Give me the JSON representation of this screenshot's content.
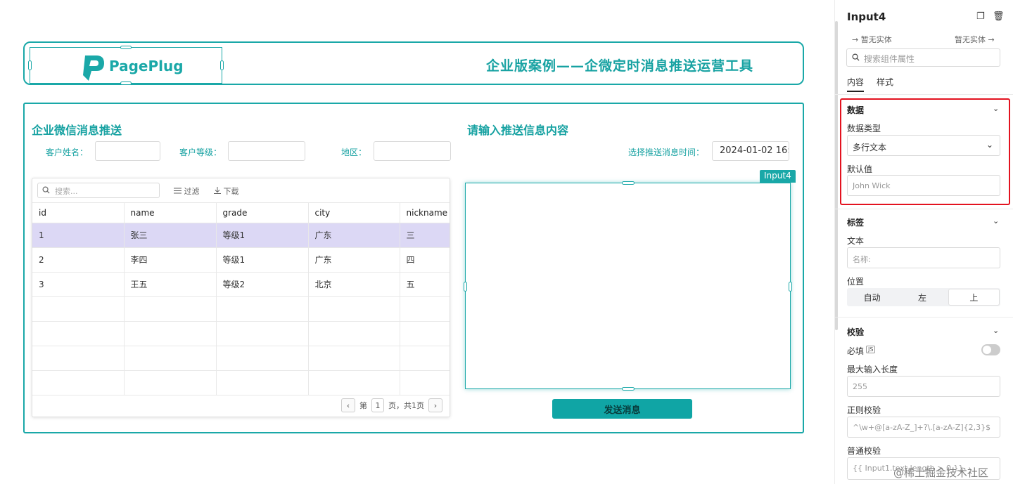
{
  "header": {
    "logo_text": "PagePlug",
    "title": "企业版案例——企微定时消息推送运营工具"
  },
  "main": {
    "left_title": "企业微信消息推送",
    "right_title": "请输入推送信息内容",
    "filters": [
      {
        "label": "客户姓名：",
        "value": ""
      },
      {
        "label": "客户等级：",
        "value": ""
      },
      {
        "label": "地区：",
        "value": ""
      }
    ],
    "schedule_label": "选择推送消息时间：",
    "schedule_value": "2024-01-02 16:",
    "table": {
      "search_placeholder": "搜索...",
      "filter_label": "过滤",
      "download_label": "下载",
      "columns": [
        "id",
        "name",
        "grade",
        "city",
        "nickname"
      ],
      "rows": [
        [
          "1",
          "张三",
          "等级1",
          "广东",
          "三"
        ],
        [
          "2",
          "李四",
          "等级1",
          "广东",
          "四"
        ],
        [
          "3",
          "王五",
          "等级2",
          "北京",
          "五"
        ]
      ],
      "pager": {
        "prefix": "第",
        "page": "1",
        "suffix": "页，共1页"
      }
    },
    "widget_tag": "Input4",
    "send_button": "发送消息"
  },
  "pane": {
    "title": "Input4",
    "entity_left": "暂无实体",
    "entity_right": "暂无实体",
    "search_placeholder": "搜索组件属性",
    "tabs": [
      "内容",
      "样式"
    ],
    "data_section": {
      "title": "数据",
      "type_label": "数据类型",
      "type_value": "多行文本",
      "default_label": "默认值",
      "default_placeholder": "John Wick"
    },
    "label_section": {
      "title": "标签",
      "text_label": "文本",
      "text_placeholder": "名称:",
      "position_label": "位置",
      "positions": [
        "自动",
        "左",
        "上"
      ]
    },
    "validation_section": {
      "title": "校验",
      "required_label": "必填",
      "js_badge": "JS",
      "maxlen_label": "最大输入长度",
      "maxlen_placeholder": "255",
      "regex_label": "正则校验",
      "regex_placeholder": "^\\w+@[a-zA-Z_]+?\\.[a-zA-Z]{2,3}$",
      "custom_label": "普通校验",
      "custom_placeholder": "{{ Input1.text.length > 0 }}"
    },
    "accent": "#1aa8a8",
    "highlight": "#e3121f"
  },
  "watermark": "@稀土掘金技术社区"
}
